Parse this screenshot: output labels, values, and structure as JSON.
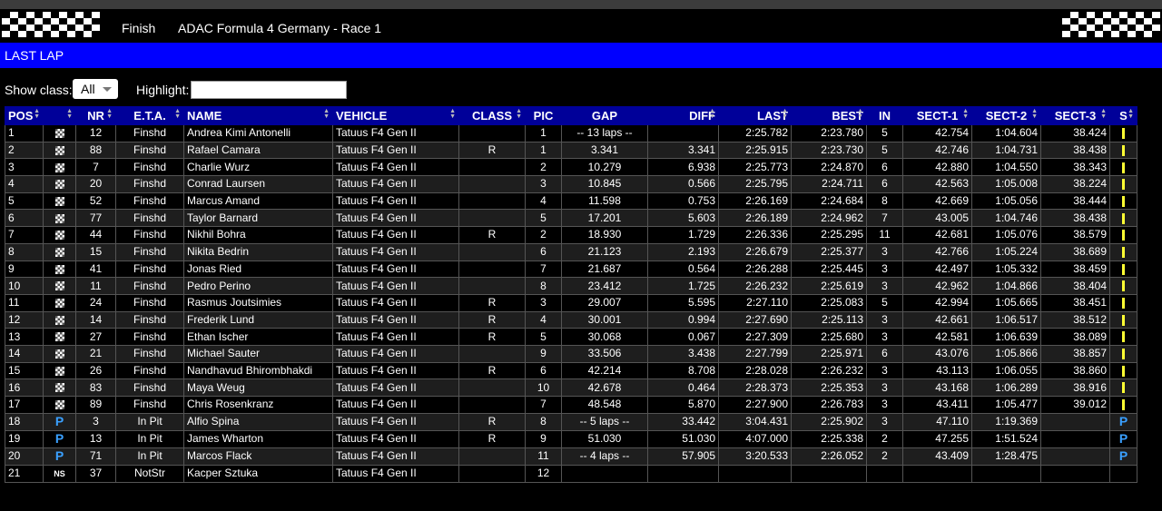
{
  "header": {
    "status": "Finish",
    "title": "ADAC Formula 4 Germany - Race 1"
  },
  "section": {
    "label": "LAST LAP"
  },
  "controls": {
    "show_class_label": "Show class:",
    "show_class_value": "All",
    "highlight_label": "Highlight:",
    "highlight_value": ""
  },
  "columns": [
    "POS",
    "",
    "NR",
    "E.T.A.",
    "NAME",
    "VEHICLE",
    "CLASS",
    "PIC",
    "GAP",
    "DIFF",
    "LAST",
    "BEST",
    "IN",
    "SECT-1",
    "SECT-2",
    "SECT-3",
    "S"
  ],
  "rows": [
    {
      "pos": "1",
      "status": "finish",
      "nr": "12",
      "eta": "Finshd",
      "name": "Andrea Kimi Antonelli",
      "vehicle": "Tatuus F4 Gen II",
      "class": "",
      "pic": "1",
      "gap": "-- 13 laps --",
      "diff": "",
      "last": "2:25.782",
      "best": "2:23.780",
      "in": "5",
      "s1": "42.754",
      "s2": "1:04.604",
      "s3": "38.424",
      "s": "bar"
    },
    {
      "pos": "2",
      "status": "finish",
      "nr": "88",
      "eta": "Finshd",
      "name": "Rafael Camara",
      "vehicle": "Tatuus F4 Gen II",
      "class": "R",
      "pic": "1",
      "gap": "3.341",
      "diff": "3.341",
      "last": "2:25.915",
      "best": "2:23.730",
      "in": "5",
      "s1": "42.746",
      "s2": "1:04.731",
      "s3": "38.438",
      "s": "bar"
    },
    {
      "pos": "3",
      "status": "finish",
      "nr": "7",
      "eta": "Finshd",
      "name": "Charlie Wurz",
      "vehicle": "Tatuus F4 Gen II",
      "class": "",
      "pic": "2",
      "gap": "10.279",
      "diff": "6.938",
      "last": "2:25.773",
      "best": "2:24.870",
      "in": "6",
      "s1": "42.880",
      "s2": "1:04.550",
      "s3": "38.343",
      "s": "bar"
    },
    {
      "pos": "4",
      "status": "finish",
      "nr": "20",
      "eta": "Finshd",
      "name": "Conrad Laursen",
      "vehicle": "Tatuus F4 Gen II",
      "class": "",
      "pic": "3",
      "gap": "10.845",
      "diff": "0.566",
      "last": "2:25.795",
      "best": "2:24.711",
      "in": "6",
      "s1": "42.563",
      "s2": "1:05.008",
      "s3": "38.224",
      "s": "bar"
    },
    {
      "pos": "5",
      "status": "finish",
      "nr": "52",
      "eta": "Finshd",
      "name": "Marcus Amand",
      "vehicle": "Tatuus F4 Gen II",
      "class": "",
      "pic": "4",
      "gap": "11.598",
      "diff": "0.753",
      "last": "2:26.169",
      "best": "2:24.684",
      "in": "8",
      "s1": "42.669",
      "s2": "1:05.056",
      "s3": "38.444",
      "s": "bar"
    },
    {
      "pos": "6",
      "status": "finish",
      "nr": "77",
      "eta": "Finshd",
      "name": "Taylor Barnard",
      "vehicle": "Tatuus F4 Gen II",
      "class": "",
      "pic": "5",
      "gap": "17.201",
      "diff": "5.603",
      "last": "2:26.189",
      "best": "2:24.962",
      "in": "7",
      "s1": "43.005",
      "s2": "1:04.746",
      "s3": "38.438",
      "s": "bar"
    },
    {
      "pos": "7",
      "status": "finish",
      "nr": "44",
      "eta": "Finshd",
      "name": "Nikhil  Bohra",
      "vehicle": "Tatuus F4 Gen II",
      "class": "R",
      "pic": "2",
      "gap": "18.930",
      "diff": "1.729",
      "last": "2:26.336",
      "best": "2:25.295",
      "in": "11",
      "s1": "42.681",
      "s2": "1:05.076",
      "s3": "38.579",
      "s": "bar"
    },
    {
      "pos": "8",
      "status": "finish",
      "nr": "15",
      "eta": "Finshd",
      "name": "Nikita Bedrin",
      "vehicle": "Tatuus F4 Gen II",
      "class": "",
      "pic": "6",
      "gap": "21.123",
      "diff": "2.193",
      "last": "2:26.679",
      "best": "2:25.377",
      "in": "3",
      "s1": "42.766",
      "s2": "1:05.224",
      "s3": "38.689",
      "s": "bar"
    },
    {
      "pos": "9",
      "status": "finish",
      "nr": "41",
      "eta": "Finshd",
      "name": "Jonas Ried",
      "vehicle": "Tatuus F4 Gen II",
      "class": "",
      "pic": "7",
      "gap": "21.687",
      "diff": "0.564",
      "last": "2:26.288",
      "best": "2:25.445",
      "in": "3",
      "s1": "42.497",
      "s2": "1:05.332",
      "s3": "38.459",
      "s": "bar"
    },
    {
      "pos": "10",
      "status": "finish",
      "nr": "11",
      "eta": "Finshd",
      "name": "Pedro Perino",
      "vehicle": "Tatuus F4 Gen II",
      "class": "",
      "pic": "8",
      "gap": "23.412",
      "diff": "1.725",
      "last": "2:26.232",
      "best": "2:25.619",
      "in": "3",
      "s1": "42.962",
      "s2": "1:04.866",
      "s3": "38.404",
      "s": "bar"
    },
    {
      "pos": "11",
      "status": "finish",
      "nr": "24",
      "eta": "Finshd",
      "name": "Rasmus Joutsimies",
      "vehicle": "Tatuus F4 Gen II",
      "class": "R",
      "pic": "3",
      "gap": "29.007",
      "diff": "5.595",
      "last": "2:27.110",
      "best": "2:25.083",
      "in": "5",
      "s1": "42.994",
      "s2": "1:05.665",
      "s3": "38.451",
      "s": "bar"
    },
    {
      "pos": "12",
      "status": "finish",
      "nr": "14",
      "eta": "Finshd",
      "name": "Frederik Lund",
      "vehicle": "Tatuus F4 Gen II",
      "class": "R",
      "pic": "4",
      "gap": "30.001",
      "diff": "0.994",
      "last": "2:27.690",
      "best": "2:25.113",
      "in": "3",
      "s1": "42.661",
      "s2": "1:06.517",
      "s3": "38.512",
      "s": "bar"
    },
    {
      "pos": "13",
      "status": "finish",
      "nr": "27",
      "eta": "Finshd",
      "name": "Ethan Ischer",
      "vehicle": "Tatuus F4 Gen II",
      "class": "R",
      "pic": "5",
      "gap": "30.068",
      "diff": "0.067",
      "last": "2:27.309",
      "best": "2:25.680",
      "in": "3",
      "s1": "42.581",
      "s2": "1:06.639",
      "s3": "38.089",
      "s": "bar"
    },
    {
      "pos": "14",
      "status": "finish",
      "nr": "21",
      "eta": "Finshd",
      "name": "Michael Sauter",
      "vehicle": "Tatuus F4 Gen II",
      "class": "",
      "pic": "9",
      "gap": "33.506",
      "diff": "3.438",
      "last": "2:27.799",
      "best": "2:25.971",
      "in": "6",
      "s1": "43.076",
      "s2": "1:05.866",
      "s3": "38.857",
      "s": "bar"
    },
    {
      "pos": "15",
      "status": "finish",
      "nr": "26",
      "eta": "Finshd",
      "name": "Nandhavud Bhirombhakdi",
      "vehicle": "Tatuus F4 Gen II",
      "class": "R",
      "pic": "6",
      "gap": "42.214",
      "diff": "8.708",
      "last": "2:28.028",
      "best": "2:26.232",
      "in": "3",
      "s1": "43.113",
      "s2": "1:06.055",
      "s3": "38.860",
      "s": "bar"
    },
    {
      "pos": "16",
      "status": "finish",
      "nr": "83",
      "eta": "Finshd",
      "name": "Maya Weug",
      "vehicle": "Tatuus F4 Gen II",
      "class": "",
      "pic": "10",
      "gap": "42.678",
      "diff": "0.464",
      "last": "2:28.373",
      "best": "2:25.353",
      "in": "3",
      "s1": "43.168",
      "s2": "1:06.289",
      "s3": "38.916",
      "s": "bar"
    },
    {
      "pos": "17",
      "status": "finish",
      "nr": "89",
      "eta": "Finshd",
      "name": "Chris Rosenkranz",
      "vehicle": "Tatuus F4 Gen II",
      "class": "",
      "pic": "7",
      "gap": "48.548",
      "diff": "5.870",
      "last": "2:27.900",
      "best": "2:26.783",
      "in": "3",
      "s1": "43.411",
      "s2": "1:05.477",
      "s3": "39.012",
      "s": "bar"
    },
    {
      "pos": "18",
      "status": "P",
      "nr": "3",
      "eta": "In Pit",
      "name": "Alfio Spina",
      "vehicle": "Tatuus F4 Gen II",
      "class": "R",
      "pic": "8",
      "gap": "-- 5 laps --",
      "diff": "33.442",
      "last": "3:04.431",
      "best": "2:25.902",
      "in": "3",
      "s1": "47.110",
      "s2": "1:19.369",
      "s3": "",
      "s": "P"
    },
    {
      "pos": "19",
      "status": "P",
      "nr": "13",
      "eta": "In Pit",
      "name": "James Wharton",
      "vehicle": "Tatuus F4 Gen II",
      "class": "R",
      "pic": "9",
      "gap": "51.030",
      "diff": "51.030",
      "last": "4:07.000",
      "best": "2:25.338",
      "in": "2",
      "s1": "47.255",
      "s2": "1:51.524",
      "s3": "",
      "s": "P"
    },
    {
      "pos": "20",
      "status": "P",
      "nr": "71",
      "eta": "In Pit",
      "name": "Marcos Flack",
      "vehicle": "Tatuus F4 Gen II",
      "class": "",
      "pic": "11",
      "gap": "-- 4 laps --",
      "diff": "57.905",
      "last": "3:20.533",
      "best": "2:26.052",
      "in": "2",
      "s1": "43.409",
      "s2": "1:28.475",
      "s3": "",
      "s": "P"
    },
    {
      "pos": "21",
      "status": "NS",
      "nr": "37",
      "eta": "NotStr",
      "name": "Kacper Sztuka",
      "vehicle": "Tatuus F4 Gen II",
      "class": "",
      "pic": "12",
      "gap": "",
      "diff": "",
      "last": "",
      "best": "",
      "in": "",
      "s1": "",
      "s2": "",
      "s3": "",
      "s": ""
    }
  ]
}
